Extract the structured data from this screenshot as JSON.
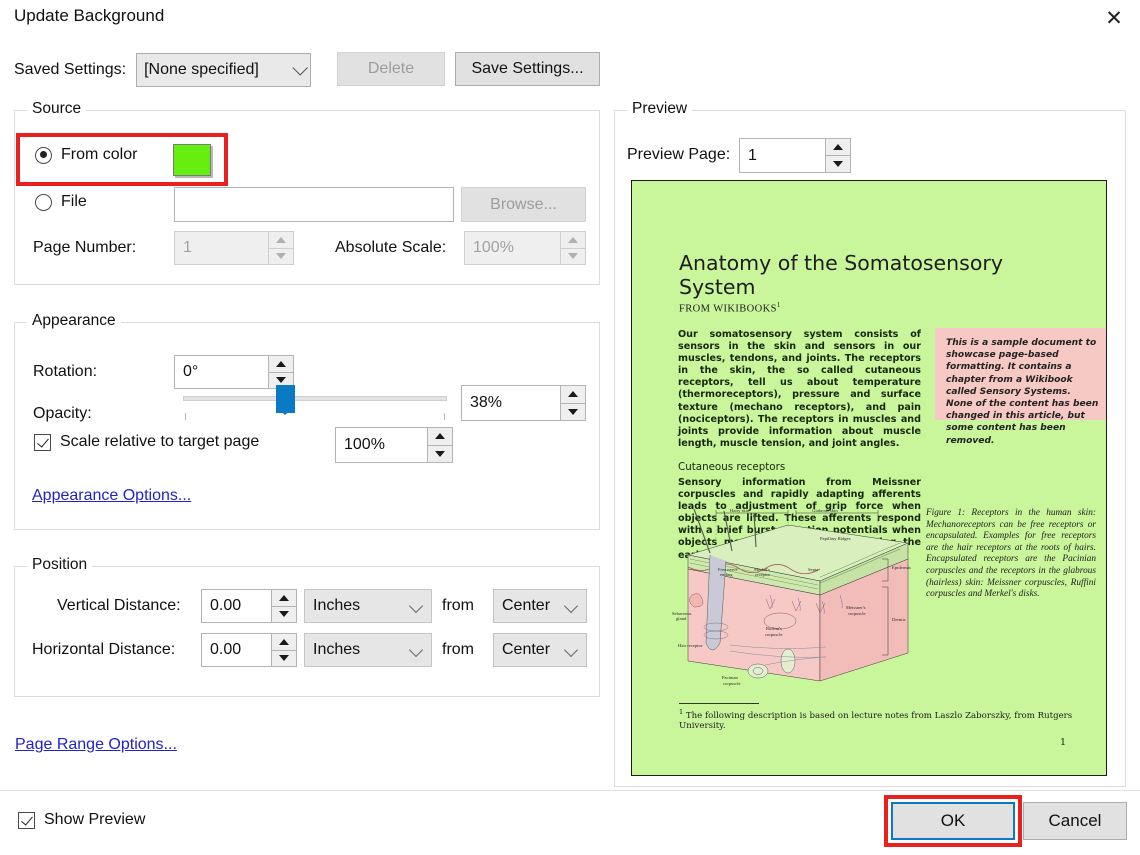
{
  "dialog": {
    "title": "Update Background",
    "close_icon": "close-icon"
  },
  "saved_settings": {
    "label": "Saved Settings:",
    "value": "[None specified]",
    "delete_label": "Delete",
    "save_label": "Save Settings..."
  },
  "source": {
    "legend": "Source",
    "from_color_label": "From color",
    "from_color_selected": true,
    "color_swatch": "#66ee11",
    "file_label": "File",
    "file_value": "",
    "browse_label": "Browse...",
    "page_number_label": "Page Number:",
    "page_number_value": "1",
    "absolute_scale_label": "Absolute Scale:",
    "absolute_scale_value": "100%"
  },
  "appearance": {
    "legend": "Appearance",
    "rotation_label": "Rotation:",
    "rotation_value": "0°",
    "opacity_label": "Opacity:",
    "opacity_value": "38%",
    "opacity_percent": 38,
    "scale_checkbox_label": "Scale relative to target page",
    "scale_checked": true,
    "scale_value": "100%",
    "options_link": "Appearance Options..."
  },
  "position": {
    "legend": "Position",
    "vertical_label": "Vertical Distance:",
    "vertical_value": "0.00",
    "vertical_units": "Inches",
    "vertical_from_label": "from",
    "vertical_origin": "Center",
    "horizontal_label": "Horizontal Distance:",
    "horizontal_value": "0.00",
    "horizontal_units": "Inches",
    "horizontal_from_label": "from",
    "horizontal_origin": "Center"
  },
  "page_range": {
    "link": "Page Range Options..."
  },
  "show_preview": {
    "label": "Show Preview",
    "checked": true
  },
  "preview": {
    "legend": "Preview",
    "page_label": "Preview Page:",
    "page_value": "1",
    "page_background": "#c9f59b",
    "document": {
      "title": "Anatomy of the Somatosensory System",
      "byline": "FROM WIKIBOOKS",
      "byline_footnote_marker": "1",
      "intro_paragraph": "Our somatosensory system consists of sensors in the skin and sensors in our muscles, tendons, and joints. The receptors in the skin, the so called cutaneous receptors, tell us about temperature (thermoreceptors), pressure and surface texture (mechano receptors), and pain (nociceptors). The receptors in muscles and joints provide information about muscle length, muscle tension, and joint angles.",
      "section_heading": "Cutaneous receptors",
      "section_paragraph": "Sensory information from Meissner corpuscles and rapidly adapting afferents leads to adjustment of grip force when objects are lifted. These afferents respond with a brief burst of action potentials when objects move a small distance during the early stages of lifting. In response to",
      "sidebar_note": "This is a sample document to showcase page-based formatting. It contains a chapter from a Wikibook called Sensory Systems. None of the content has been changed in this article, but some content has been removed.",
      "figure_caption": "Figure 1: Receptors in the human skin: Mechanoreceptors can be free receptors or encapsulated. Examples for free receptors are the hair receptors at the roots of hairs. Encapsulated receptors are the Pacinian corpuscles and the receptors in the glabrous (hairless) skin: Meissner corpuscles, Ruffini corpuscles and Merkel's disks.",
      "footnote_marker": "1",
      "footnote": "The following description is based on lecture notes from Laszlo Zaborszky, from Rutgers University.",
      "page_number": "1",
      "figure_labels": {
        "hairy_skin": "Hairy skin",
        "glabrous_skin": "Glabrous skin",
        "papillary_ridges": "Papillary Ridges",
        "septa": "Septa",
        "epidermis": "Epidermis",
        "dermis": "Dermis",
        "free_nerve_ending": "Free nerve ending",
        "merkel_receptor": "Merkel's receptor",
        "sebaceous_gland": "Sebaceous gland",
        "ruffinis_corpuscle": "Ruffini's corpuscle",
        "meissners_corpuscle": "Meissner's corpuscle",
        "hair_receptor": "Hair receptor",
        "pacinian_corpuscle": "Pacinian corpuscle"
      }
    }
  },
  "footer": {
    "ok_label": "OK",
    "cancel_label": "Cancel"
  },
  "annotations": {
    "highlight_color": "#e8201e"
  }
}
